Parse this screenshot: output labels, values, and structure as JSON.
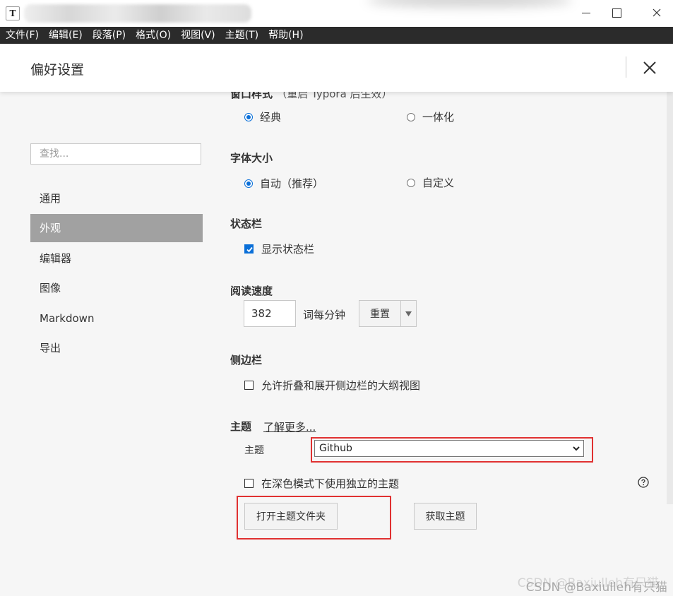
{
  "window": {
    "app_icon_letter": "T"
  },
  "menu": [
    {
      "label": "文件(F)"
    },
    {
      "label": "编辑(E)"
    },
    {
      "label": "段落(P)"
    },
    {
      "label": "格式(O)"
    },
    {
      "label": "视图(V)"
    },
    {
      "label": "主题(T)"
    },
    {
      "label": "帮助(H)"
    }
  ],
  "preferences": {
    "title": "偏好设置"
  },
  "sidebar": {
    "search_placeholder": "查找...",
    "items": [
      {
        "label": "通用"
      },
      {
        "label": "外观",
        "active": true
      },
      {
        "label": "编辑器"
      },
      {
        "label": "图像"
      },
      {
        "label": "Markdown"
      },
      {
        "label": "导出"
      }
    ]
  },
  "sections": {
    "window_style": {
      "title": "窗口样式",
      "note": "（重启 Typora 后生效）",
      "options": [
        {
          "label": "经典",
          "selected": true
        },
        {
          "label": "一体化",
          "selected": false
        }
      ]
    },
    "font_size": {
      "title": "字体大小",
      "options": [
        {
          "label": "自动（推荐）",
          "selected": true
        },
        {
          "label": "自定义",
          "selected": false
        }
      ]
    },
    "status_bar": {
      "title": "状态栏",
      "checkbox_label": "显示状态栏",
      "checked": true
    },
    "reading_speed": {
      "title": "阅读速度",
      "value": "382",
      "unit": "词每分钟",
      "reset_label": "重置"
    },
    "sidebar_section": {
      "title": "侧边栏",
      "checkbox_label": "允许折叠和展开侧边栏的大纲视图",
      "checked": false
    },
    "theme": {
      "title": "主题",
      "learn_more": "了解更多...",
      "field_label": "主题",
      "selected_value": "Github",
      "dark_mode_label": "在深色模式下使用独立的主题",
      "dark_mode_checked": false,
      "open_folder_label": "打开主题文件夹",
      "get_themes_label": "获取主题"
    }
  },
  "watermark": "CSDN @Baxiulleh有只猫",
  "colors": {
    "menubar": "#2b2b2b",
    "accent": "#0a6fd8",
    "active_item": "#a1a1a1",
    "highlight": "#e03131"
  }
}
